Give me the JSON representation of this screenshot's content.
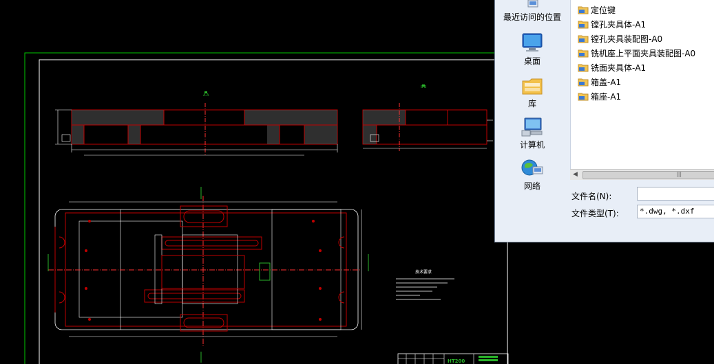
{
  "dialog": {
    "places": [
      {
        "label": "最近访问的位置",
        "icon": "recent-places-icon"
      },
      {
        "label": "桌面",
        "icon": "desktop-icon"
      },
      {
        "label": "库",
        "icon": "libraries-icon"
      },
      {
        "label": "计算机",
        "icon": "computer-icon"
      },
      {
        "label": "网络",
        "icon": "network-icon"
      }
    ],
    "files": [
      {
        "name": "定位键"
      },
      {
        "name": "镗孔夹具体-A1"
      },
      {
        "name": "镗孔夹具装配图-A0"
      },
      {
        "name": "铣机座上平面夹具装配图-A0"
      },
      {
        "name": "铣面夹具体-A1"
      },
      {
        "name": "箱盖-A1"
      },
      {
        "name": "箱座-A1"
      }
    ],
    "file_name_label": "文件名(N):",
    "file_name_value": "",
    "file_type_label": "文件类型(T):",
    "file_type_value": "*.dwg, *.dxf"
  },
  "drawing": {
    "tech_req_title": "技术要求",
    "title_block_text": "HT200",
    "section_a": "A-A",
    "section_b": "B-B"
  },
  "colors": {
    "frame": "#00c800",
    "border": "#ffffff",
    "part": "#c00000",
    "dimension": "#ffffff",
    "center": "#ff3030",
    "accent": "#2ab52a",
    "dialog_bg": "#e8eef7"
  }
}
